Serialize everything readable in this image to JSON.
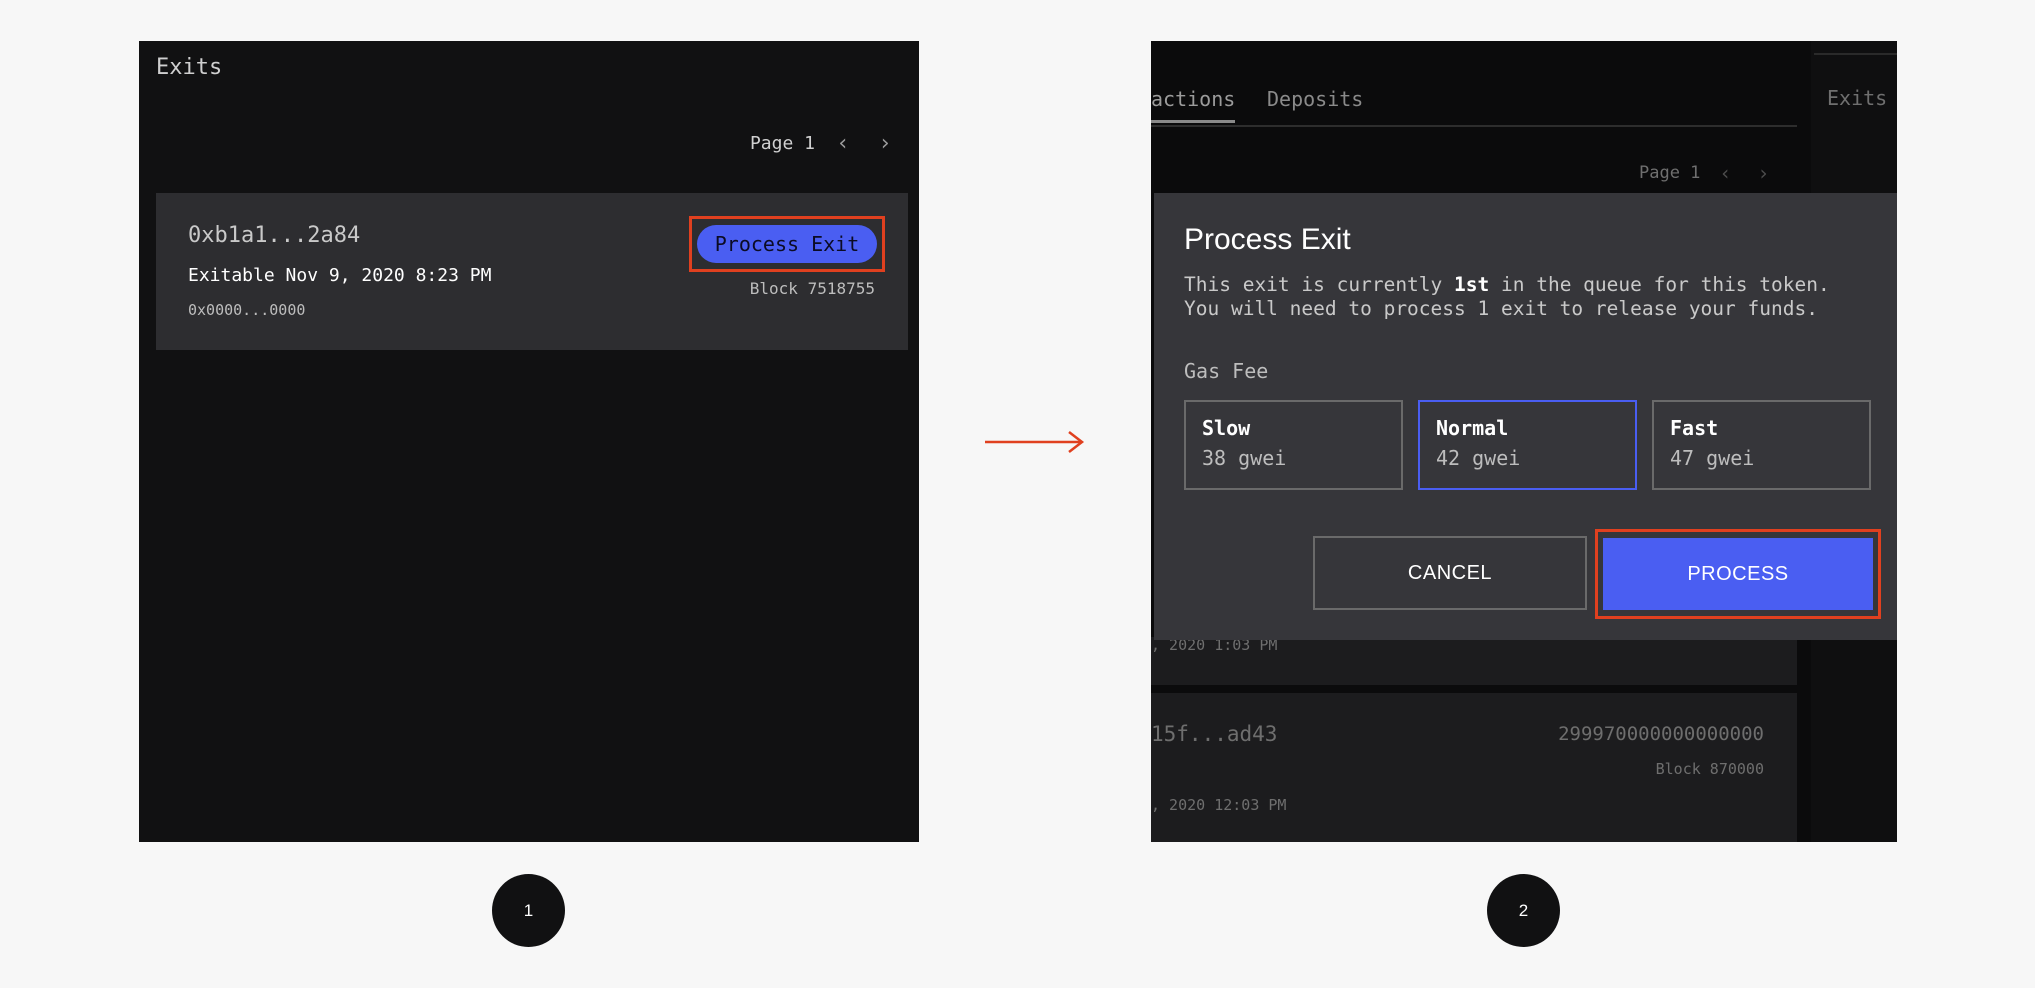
{
  "step1": {
    "title": "Exits",
    "pager": {
      "label": "Page 1"
    },
    "exit": {
      "hash": "0xb1a1...2a84",
      "exitable": "Exitable Nov 9, 2020 8:23 PM",
      "address": "0x0000...0000",
      "block": "Block 7518755",
      "button_label": "Process Exit"
    }
  },
  "step2": {
    "tabs": [
      "actions",
      "Deposits"
    ],
    "sidebar_label": "Exits",
    "pager": {
      "label": "Page 1"
    },
    "background_rows": {
      "row_a_date": ", 2020 1:03 PM",
      "row_b_hash": "15f...ad43",
      "row_b_value": "299970000000000000",
      "row_b_block": "Block 870000",
      "row_b_date": ", 2020 12:03 PM"
    },
    "modal": {
      "title": "Process Exit",
      "desc_before": "This exit is currently ",
      "desc_bold": "1st",
      "desc_after": " in the queue for this token. You will need to process 1 exit to release your funds.",
      "gas_label": "Gas Fee",
      "gas_options": [
        {
          "name": "Slow",
          "value": "38 gwei"
        },
        {
          "name": "Normal",
          "value": "42 gwei"
        },
        {
          "name": "Fast",
          "value": "47 gwei"
        }
      ],
      "selected_gas": "Normal",
      "cancel_label": "CANCEL",
      "process_label": "PROCESS"
    }
  },
  "steps": [
    "1",
    "2"
  ],
  "colors": {
    "accent": "#4a5ef2",
    "highlight": "#e0401f",
    "panel_bg": "#111112",
    "modal_bg": "#36363a"
  }
}
